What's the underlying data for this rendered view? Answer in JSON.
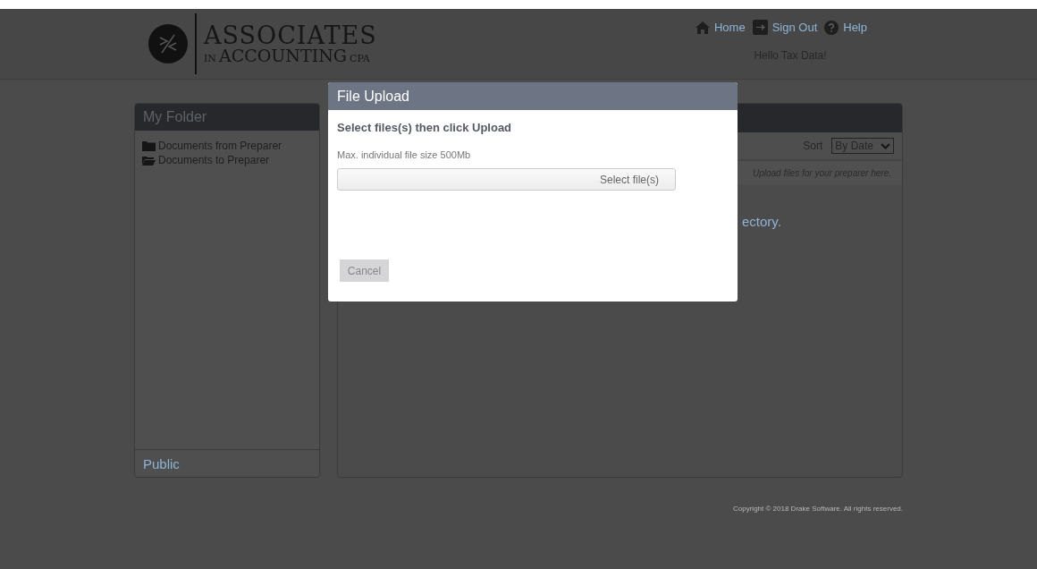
{
  "header": {
    "logo": {
      "line1": "ASSOCIATES",
      "prefix": "IN",
      "line2": "ACCOUNTING",
      "suffix": "CPA"
    },
    "nav": [
      {
        "label": "Home",
        "kind": "home"
      },
      {
        "label": "Sign Out",
        "kind": "signout"
      },
      {
        "label": "Help",
        "kind": "help"
      }
    ],
    "greeting": "Hello Tax Data!"
  },
  "folder_panel": {
    "title": "My Folder",
    "items": [
      {
        "label": "Documents from Preparer",
        "kind": "closed"
      },
      {
        "label": "Documents to Preparer",
        "kind": "open"
      }
    ],
    "footer": "Public"
  },
  "content_panel": {
    "sort_label": "Sort",
    "sort_value": "By Date",
    "hint": "Upload files for your preparer here.",
    "message": "ectory."
  },
  "dialog": {
    "title": "File Upload",
    "heading": "Select files(s) then click Upload",
    "note": "Max. individual file size 500Mb",
    "select_button": "Select file(s)",
    "cancel_button": "Cancel"
  },
  "footer": {
    "copyright": "Copyright © 2018 Drake Software. All rights reserved."
  }
}
